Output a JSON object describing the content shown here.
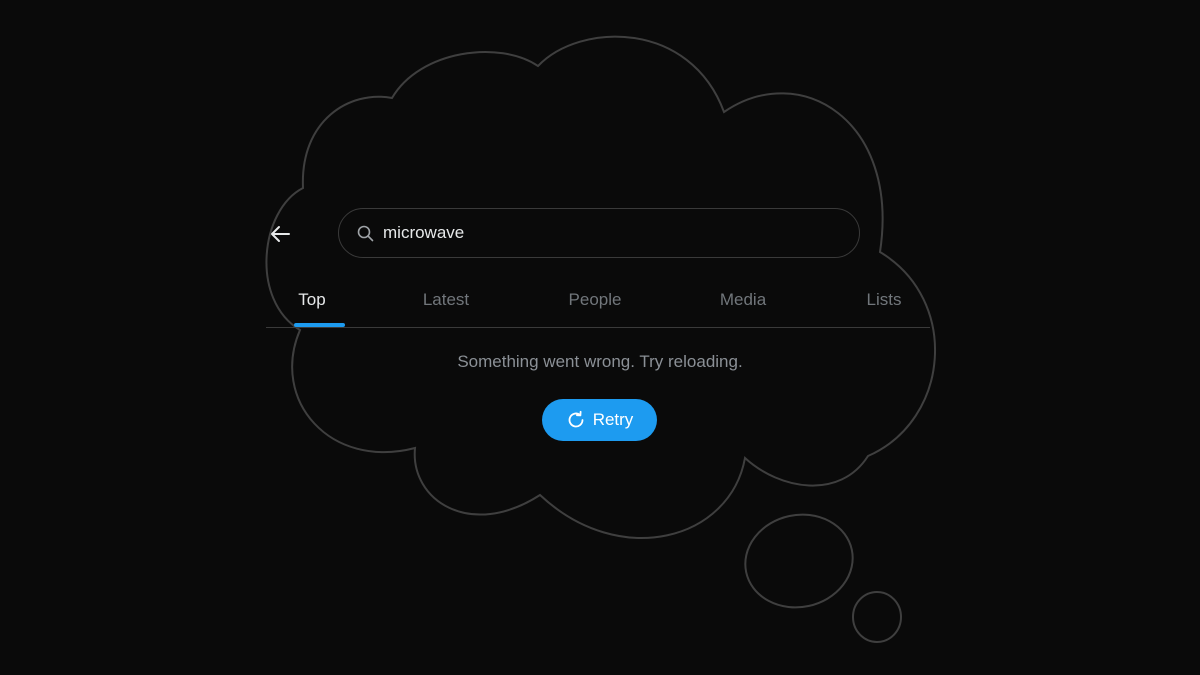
{
  "search": {
    "value": "microwave",
    "icon": "search-icon"
  },
  "back": {
    "icon": "arrow-left-icon"
  },
  "tabs": [
    {
      "label": "Top",
      "active": true
    },
    {
      "label": "Latest",
      "active": false
    },
    {
      "label": "People",
      "active": false
    },
    {
      "label": "Media",
      "active": false
    },
    {
      "label": "Lists",
      "active": false
    }
  ],
  "error": {
    "message": "Something went wrong. Try reloading."
  },
  "retry": {
    "label": "Retry",
    "icon": "refresh-icon"
  },
  "colors": {
    "background": "#0a0a0a",
    "accent": "#1d9bf0",
    "text_primary": "#e7e9ea",
    "text_secondary": "#71767b",
    "outline": "#3a3a3a"
  }
}
